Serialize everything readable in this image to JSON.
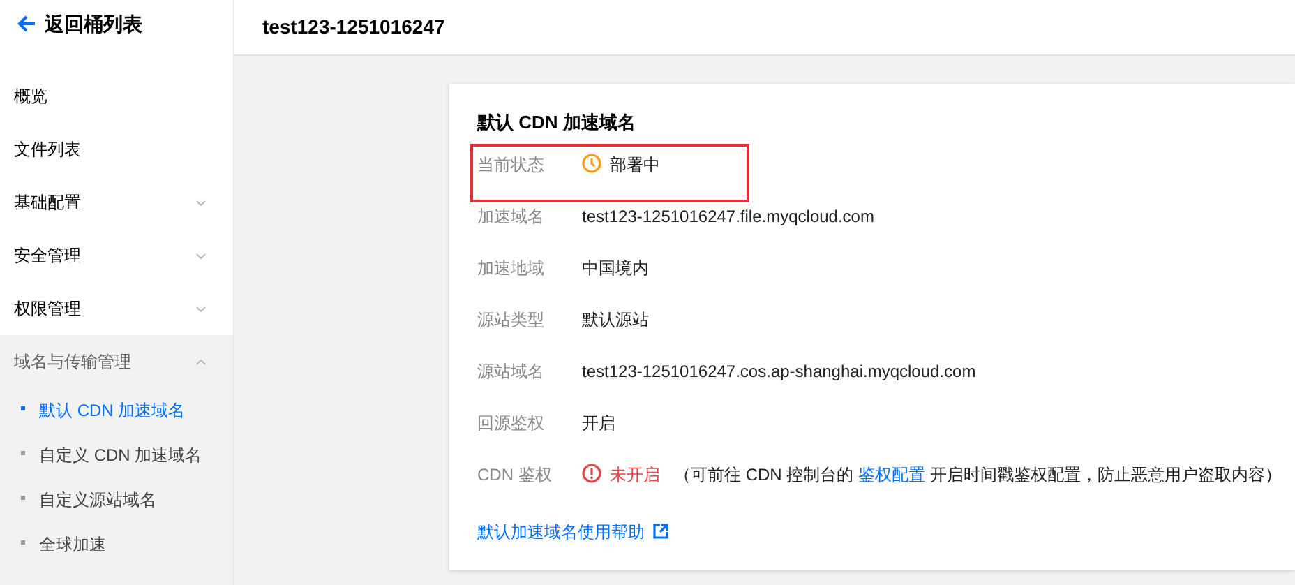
{
  "back_link": "返回桶列表",
  "header": {
    "title": "test123-1251016247"
  },
  "sidebar": {
    "items": [
      {
        "label": "概览",
        "kind": "item"
      },
      {
        "label": "文件列表",
        "kind": "item"
      },
      {
        "label": "基础配置",
        "kind": "group",
        "expanded": false
      },
      {
        "label": "安全管理",
        "kind": "group",
        "expanded": false
      },
      {
        "label": "权限管理",
        "kind": "group",
        "expanded": false
      },
      {
        "label": "域名与传输管理",
        "kind": "group",
        "expanded": true,
        "children": [
          {
            "label": "默认 CDN 加速域名",
            "selected": true
          },
          {
            "label": "自定义 CDN 加速域名",
            "selected": false
          },
          {
            "label": "自定义源站域名",
            "selected": false
          },
          {
            "label": "全球加速",
            "selected": false
          }
        ]
      }
    ]
  },
  "card": {
    "title": "默认 CDN 加速域名",
    "rows": [
      {
        "label": "当前状态",
        "kind": "status",
        "value": "部署中",
        "color": "#ff9c19",
        "highlighted": true
      },
      {
        "label": "加速域名",
        "kind": "text",
        "value": "test123-1251016247.file.myqcloud.com"
      },
      {
        "label": "加速地域",
        "kind": "text",
        "value": "中国境内"
      },
      {
        "label": "源站类型",
        "kind": "text",
        "value": "默认源站"
      },
      {
        "label": "源站域名",
        "kind": "text",
        "value": "test123-1251016247.cos.ap-shanghai.myqcloud.com"
      },
      {
        "label": "回源鉴权",
        "kind": "text",
        "value": "开启"
      },
      {
        "label": "CDN 鉴权",
        "kind": "warning",
        "value": "未开启",
        "color": "#e54545",
        "note_before": "（可前往 CDN 控制台的",
        "note_link": "鉴权配置",
        "note_after": "开启时间戳鉴权配置，防止恶意用户盗取内容）"
      }
    ],
    "help_link": "默认加速域名使用帮助"
  }
}
